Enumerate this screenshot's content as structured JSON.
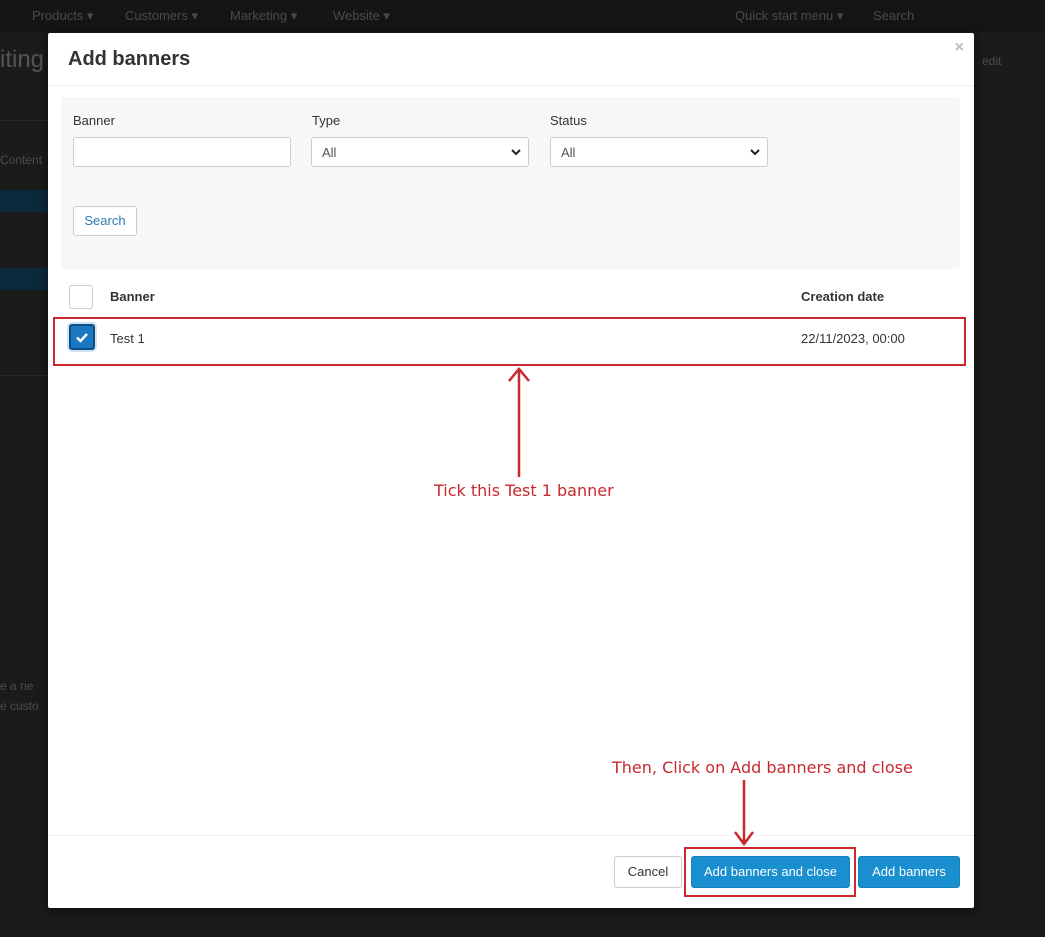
{
  "background": {
    "nav_items": [
      "Products ▾",
      "Customers ▾",
      "Marketing ▾",
      "Website ▾"
    ],
    "quick_menu": "Quick start menu ▾",
    "search": "Search",
    "heading": "iting",
    "side_text_1": "Content",
    "side_text_2": "e a ne",
    "side_text_3": "e custo",
    "right_text": "edit"
  },
  "modal": {
    "title": "Add banners",
    "close": "×",
    "filters": {
      "banner_label": "Banner",
      "banner_value": "",
      "type_label": "Type",
      "type_value": "All",
      "status_label": "Status",
      "status_value": "All",
      "search_button": "Search"
    },
    "table": {
      "headers": [
        "Banner",
        "Creation date"
      ],
      "rows": [
        {
          "banner": "Test 1",
          "creation_date": "22/11/2023, 00:00",
          "checked": true
        }
      ]
    },
    "footer": {
      "cancel": "Cancel",
      "add_and_close": "Add banners and close",
      "add": "Add banners"
    }
  },
  "annotations": {
    "tick_note": "Tick this Test 1 banner",
    "click_note": "Then, Click on Add banners and close"
  },
  "colors": {
    "primary": "#1a8fcf",
    "annotation": "#c8282e",
    "overlay": "#141414"
  }
}
